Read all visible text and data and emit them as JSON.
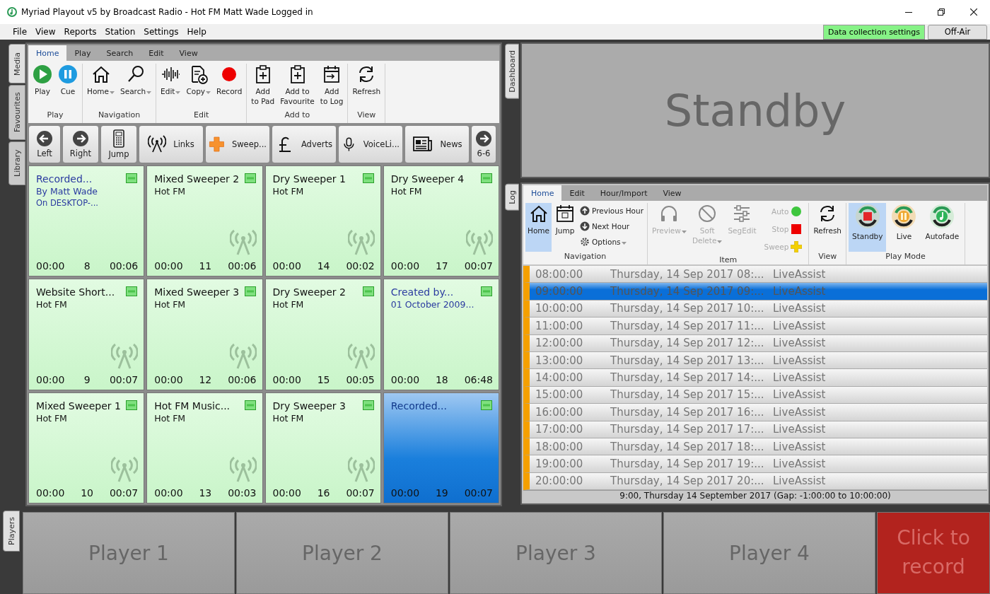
{
  "window": {
    "title": "Myriad Playout v5 by Broadcast Radio - Hot FM Matt Wade Logged in"
  },
  "menu": [
    "File",
    "View",
    "Reports",
    "Station",
    "Settings",
    "Help"
  ],
  "header_buttons": [
    {
      "label": "Data collection settings",
      "kind": "green"
    },
    {
      "label": "Off-Air",
      "kind": "plain"
    }
  ],
  "side_tabs": [
    {
      "label": "Media",
      "selected": true
    },
    {
      "label": "Favourites",
      "selected": false
    },
    {
      "label": "Library",
      "selected": false
    }
  ],
  "media_ribbon": {
    "tabs": [
      {
        "label": "Home",
        "selected": true
      },
      {
        "label": "Play",
        "selected": false
      },
      {
        "label": "Search",
        "selected": false
      },
      {
        "label": "Edit",
        "selected": false
      },
      {
        "label": "View",
        "selected": false
      }
    ],
    "groups": [
      {
        "label": "Play",
        "buttons": [
          {
            "label": "Play",
            "dropdown": false
          },
          {
            "label": "Cue",
            "dropdown": false
          }
        ]
      },
      {
        "label": "Navigation",
        "buttons": [
          {
            "label": "Home",
            "dropdown": true
          },
          {
            "label": "Search",
            "dropdown": true
          }
        ]
      },
      {
        "label": "Edit",
        "buttons": [
          {
            "label": "Edit",
            "dropdown": true
          },
          {
            "label": "Copy",
            "dropdown": true
          },
          {
            "label": "Record",
            "dropdown": false
          }
        ]
      },
      {
        "label": "Add to",
        "buttons": [
          {
            "label": "Add\nto Pad",
            "dropdown": false
          },
          {
            "label": "Add to\nFavourite",
            "dropdown": false
          },
          {
            "label": "Add\nto Log",
            "dropdown": false
          }
        ]
      },
      {
        "label": "View",
        "buttons": [
          {
            "label": "Refresh",
            "dropdown": false
          }
        ]
      }
    ]
  },
  "nav_buttons": [
    {
      "label": "Left",
      "kind": "small"
    },
    {
      "label": "Right",
      "kind": "small"
    },
    {
      "label": "Jump",
      "kind": "small"
    },
    {
      "label": "Links",
      "kind": "wide"
    },
    {
      "label": "Sweep...",
      "kind": "wide"
    },
    {
      "label": "Adverts",
      "kind": "wide"
    },
    {
      "label": "VoiceLi...",
      "kind": "wide"
    },
    {
      "label": "News",
      "kind": "wide"
    },
    {
      "label": "6-6",
      "kind": "small"
    }
  ],
  "pads": [
    {
      "title": "Recorded...",
      "lines": [
        "By Matt Wade",
        "On DESKTOP-..."
      ],
      "kind": "recording",
      "start": "00:00",
      "number": "8",
      "duration": "00:06",
      "selected": false
    },
    {
      "title": "Mixed Sweeper 2",
      "lines": [
        "Hot FM"
      ],
      "kind": "sweeper",
      "start": "00:00",
      "number": "11",
      "duration": "00:06",
      "selected": false
    },
    {
      "title": "Dry Sweeper 1",
      "lines": [
        "Hot FM"
      ],
      "kind": "sweeper",
      "start": "00:00",
      "number": "14",
      "duration": "00:02",
      "selected": false
    },
    {
      "title": "Dry Sweeper 4",
      "lines": [
        "Hot FM"
      ],
      "kind": "sweeper",
      "start": "00:00",
      "number": "17",
      "duration": "00:07",
      "selected": false
    },
    {
      "title": "Website Short...",
      "lines": [
        "Hot FM"
      ],
      "kind": "sweeper",
      "start": "00:00",
      "number": "9",
      "duration": "00:07",
      "selected": false
    },
    {
      "title": "Mixed Sweeper 3",
      "lines": [
        "Hot FM"
      ],
      "kind": "sweeper",
      "start": "00:00",
      "number": "12",
      "duration": "00:06",
      "selected": false
    },
    {
      "title": "Dry Sweeper 2",
      "lines": [
        "Hot FM"
      ],
      "kind": "sweeper",
      "start": "00:00",
      "number": "15",
      "duration": "00:05",
      "selected": false
    },
    {
      "title": "Created by...",
      "lines": [
        "01 October 2009..."
      ],
      "kind": "recording",
      "start": "00:00",
      "number": "18",
      "duration": "06:48",
      "selected": false
    },
    {
      "title": "Mixed Sweeper 1",
      "lines": [
        "Hot FM"
      ],
      "kind": "sweeper",
      "start": "00:00",
      "number": "10",
      "duration": "00:07",
      "selected": false
    },
    {
      "title": "Hot FM Music...",
      "lines": [
        "Hot FM"
      ],
      "kind": "sweeper",
      "start": "00:00",
      "number": "13",
      "duration": "00:03",
      "selected": false
    },
    {
      "title": "Dry Sweeper 3",
      "lines": [
        "Hot FM"
      ],
      "kind": "sweeper",
      "start": "00:00",
      "number": "16",
      "duration": "00:07",
      "selected": false
    },
    {
      "title": "Recorded...",
      "kind": "recording",
      "start": "00:00",
      "number": "19",
      "duration": "00:07",
      "selected": true
    }
  ],
  "dashboard": {
    "tab": "Dashboard",
    "status": "Standby"
  },
  "log": {
    "tab": "Log",
    "tabs": [
      {
        "label": "Home",
        "selected": true
      },
      {
        "label": "Edit",
        "selected": false
      },
      {
        "label": "Hour/Import",
        "selected": false
      },
      {
        "label": "View",
        "selected": false
      }
    ],
    "groups": [
      {
        "label": "Navigation",
        "buttons": [
          {
            "label": "Home",
            "kind": "large",
            "selected": true,
            "disabled": false,
            "dropdown": false
          },
          {
            "label": "Jump",
            "kind": "large",
            "selected": false,
            "disabled": false,
            "dropdown": false
          },
          {
            "label": "Previous Hour",
            "kind": "small",
            "selected": false,
            "disabled": false,
            "dropdown": false
          },
          {
            "label": "Next Hour",
            "kind": "small",
            "selected": false,
            "disabled": false,
            "dropdown": false
          },
          {
            "label": "Options",
            "kind": "small",
            "selected": false,
            "disabled": false,
            "dropdown": true
          }
        ]
      },
      {
        "label": "Item",
        "buttons": [
          {
            "label": "Preview",
            "kind": "large",
            "selected": false,
            "disabled": true,
            "dropdown": true
          },
          {
            "label": "Soft\nDelete",
            "kind": "large",
            "selected": false,
            "disabled": true,
            "dropdown": true
          },
          {
            "label": "SegEdit",
            "kind": "large",
            "selected": false,
            "disabled": true,
            "dropdown": false
          },
          {
            "label": "Auto",
            "kind": "indicator",
            "selected": false,
            "disabled": true,
            "dropdown": false
          },
          {
            "label": "Stop",
            "kind": "indicator",
            "selected": false,
            "disabled": true,
            "dropdown": false
          },
          {
            "label": "Sweep",
            "kind": "indicator",
            "selected": false,
            "disabled": true,
            "dropdown": false
          }
        ]
      },
      {
        "label": "View",
        "buttons": [
          {
            "label": "Refresh",
            "kind": "large",
            "selected": false,
            "disabled": false,
            "dropdown": false
          }
        ]
      },
      {
        "label": "Play Mode",
        "buttons": [
          {
            "label": "Standby",
            "kind": "mode",
            "selected": true,
            "disabled": false,
            "dropdown": false
          },
          {
            "label": "Live",
            "kind": "mode",
            "selected": false,
            "disabled": false,
            "dropdown": false
          },
          {
            "label": "Autofade",
            "kind": "mode",
            "selected": false,
            "disabled": false,
            "dropdown": false
          }
        ]
      }
    ],
    "rows": [
      {
        "time": "08:00:00",
        "date": "Thursday, 14 Sep 2017 08:...",
        "type": "LiveAssist",
        "selected": false
      },
      {
        "time": "09:00:00",
        "date": "Thursday, 14 Sep 2017 09:...",
        "type": "LiveAssist",
        "selected": true
      },
      {
        "time": "10:00:00",
        "date": "Thursday, 14 Sep 2017 10:...",
        "type": "LiveAssist",
        "selected": false
      },
      {
        "time": "11:00:00",
        "date": "Thursday, 14 Sep 2017 11:...",
        "type": "LiveAssist",
        "selected": false
      },
      {
        "time": "12:00:00",
        "date": "Thursday, 14 Sep 2017 12:...",
        "type": "LiveAssist",
        "selected": false
      },
      {
        "time": "13:00:00",
        "date": "Thursday, 14 Sep 2017 13:...",
        "type": "LiveAssist",
        "selected": false
      },
      {
        "time": "14:00:00",
        "date": "Thursday, 14 Sep 2017 14:...",
        "type": "LiveAssist",
        "selected": false
      },
      {
        "time": "15:00:00",
        "date": "Thursday, 14 Sep 2017 15:...",
        "type": "LiveAssist",
        "selected": false
      },
      {
        "time": "16:00:00",
        "date": "Thursday, 14 Sep 2017 16:...",
        "type": "LiveAssist",
        "selected": false
      },
      {
        "time": "17:00:00",
        "date": "Thursday, 14 Sep 2017 17:...",
        "type": "LiveAssist",
        "selected": false
      },
      {
        "time": "18:00:00",
        "date": "Thursday, 14 Sep 2017 18:...",
        "type": "LiveAssist",
        "selected": false
      },
      {
        "time": "19:00:00",
        "date": "Thursday, 14 Sep 2017 19:...",
        "type": "LiveAssist",
        "selected": false
      },
      {
        "time": "20:00:00",
        "date": "Thursday, 14 Sep 2017 20:...",
        "type": "LiveAssist",
        "selected": false
      }
    ],
    "status": "9:00, Thursday 14 September 2017 (Gap: -1:00:00 to 10:00:00)"
  },
  "players": {
    "tab": "Players",
    "buttons": [
      {
        "label": "Player 1",
        "kind": "player"
      },
      {
        "label": "Player 2",
        "kind": "player"
      },
      {
        "label": "Player 3",
        "kind": "player"
      },
      {
        "label": "Player 4",
        "kind": "player"
      },
      {
        "label": "Click to record",
        "kind": "record"
      }
    ]
  }
}
